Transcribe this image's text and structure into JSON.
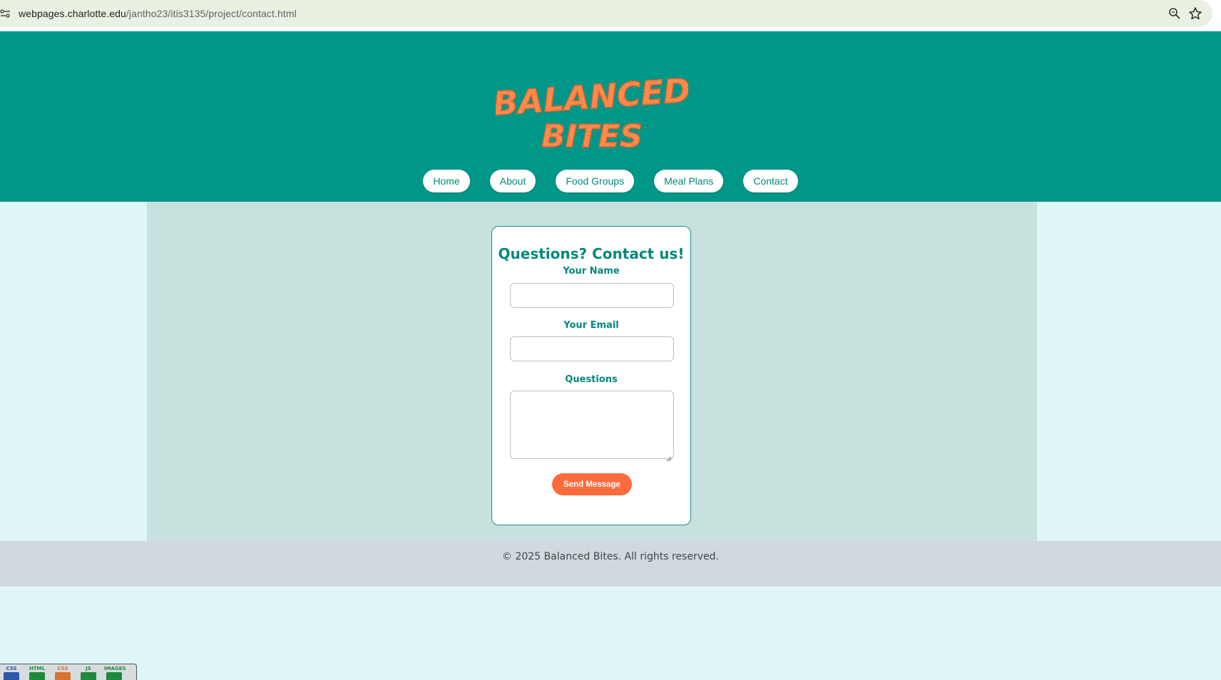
{
  "browser": {
    "url_host": "webpages.charlotte.edu",
    "url_path": "/jantho23/itis3135/project/contact.html"
  },
  "header": {
    "logo_line1": "BALANCED",
    "logo_line2": "BITES",
    "nav": [
      "Home",
      "About",
      "Food Groups",
      "Meal Plans",
      "Contact"
    ]
  },
  "form": {
    "title": "Questions? Contact us!",
    "name_label": "Your Name",
    "email_label": "Your Email",
    "questions_label": "Questions",
    "send_label": "Send Message"
  },
  "footer": {
    "text": "© 2025 Balanced Bites. All rights reserved."
  },
  "badges": [
    "CSS ON",
    "HTML",
    "CSS",
    "JS",
    "IMAGES"
  ],
  "colors": {
    "header_bg": "#009688",
    "logo_orange": "#ff8a4c",
    "accent_teal": "#00897b",
    "button_orange": "#ff6b3d",
    "page_bg": "#dff6f8",
    "panel_bg": "#c6e1de",
    "footer_bg": "#d0d9df"
  }
}
